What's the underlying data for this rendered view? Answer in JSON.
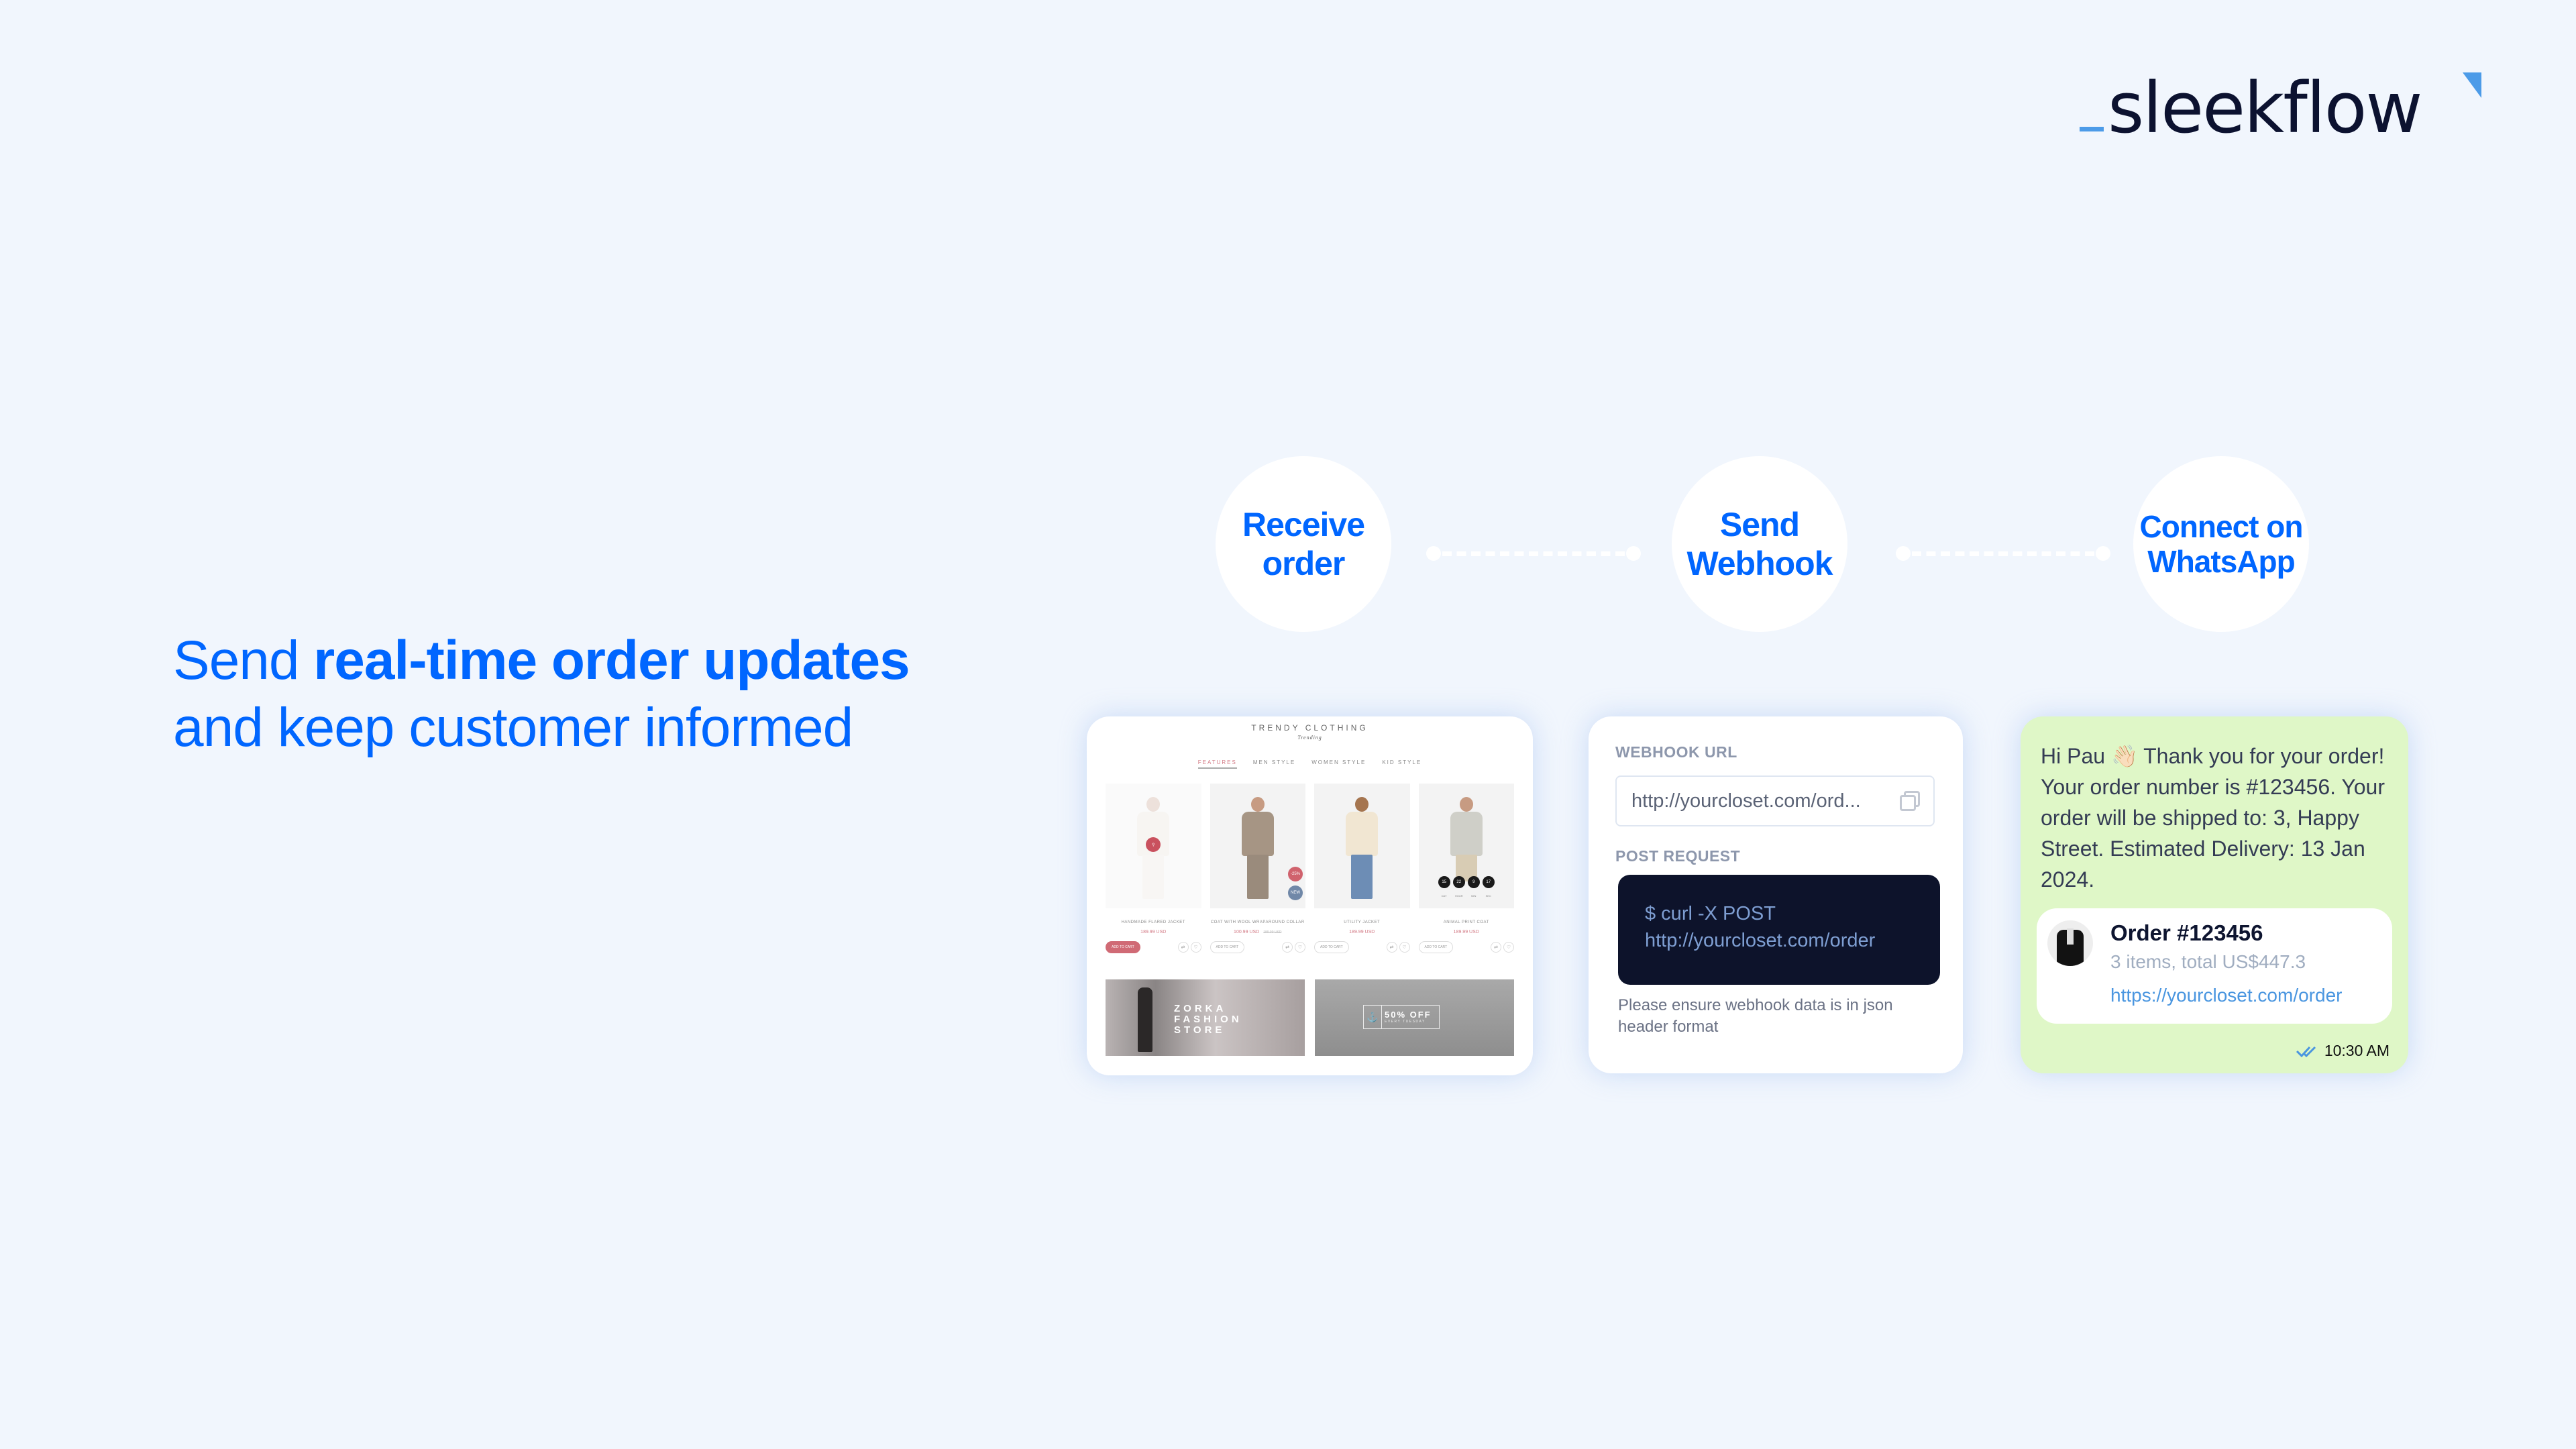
{
  "brand": {
    "logo_text": "sleekflow",
    "accent_color": "#4c9be8",
    "text_color": "#0c1230"
  },
  "headline": {
    "prefix": "Send ",
    "bold": "real-time order updates",
    "line2": "and keep customer informed",
    "color": "#0066ff"
  },
  "steps": [
    {
      "label_line1": "Receive",
      "label_line2": "order"
    },
    {
      "label_line1": "Send",
      "label_line2": "Webhook"
    },
    {
      "label_line1": "Connect on",
      "label_line2": "WhatsApp"
    }
  ],
  "shop": {
    "title": "TRENDY CLOTHING",
    "subtitle": "Trending",
    "tabs": [
      "FEATURES",
      "MEN STYLE",
      "WOMEN STYLE",
      "KID STYLE"
    ],
    "active_tab": "FEATURES",
    "products": [
      {
        "name": "HANDMADE FLARED JACKET",
        "price": "189.99 USD",
        "old_price": "",
        "cta": "ADD TO CART"
      },
      {
        "name": "COAT WITH WOOL WRAPAROUND COLLAR",
        "price": "100.99 USD",
        "old_price": "189.99 USD",
        "cta": "ADD TO CART",
        "badges": [
          "-25%",
          "NEW"
        ]
      },
      {
        "name": "UTILITY JACKET",
        "price": "189.99 USD",
        "old_price": "",
        "cta": "ADD TO CART"
      },
      {
        "name": "ANIMAL PRINT COAT",
        "price": "189.99 USD",
        "old_price": "",
        "cta": "ADD TO CART",
        "countdown": [
          {
            "value": "15",
            "unit": "DAY"
          },
          {
            "value": "22",
            "unit": "HOUR"
          },
          {
            "value": "9",
            "unit": "MIN"
          },
          {
            "value": "17",
            "unit": "SEC"
          }
        ]
      }
    ],
    "banners": [
      {
        "text": "ZORKA FASHION STORE"
      },
      {
        "big": "50% OFF",
        "small": "EVERY TUESDAY"
      }
    ]
  },
  "webhook": {
    "url_label": "WEBHOOK URL",
    "url_value": "http://yourcloset.com/ord...",
    "post_label": "POST REQUEST",
    "code_line1": "$ curl -X POST",
    "code_line2": "http://yourcloset.com/order",
    "note": "Please ensure webhook data is in json header format"
  },
  "chat": {
    "message": "Hi Pau 👋🏻 Thank you for your order! Your order number is #123456. Your order will be shipped to: 3, Happy Street. Estimated Delivery: 13 Jan 2024.",
    "order_title": "Order #123456",
    "order_summary": "3 items, total US$447.3",
    "order_link": "https://yourcloset.com/order",
    "time": "10:30 AM",
    "bubble_color": "#dff7c7",
    "read_tick_color": "#4a96e0"
  }
}
